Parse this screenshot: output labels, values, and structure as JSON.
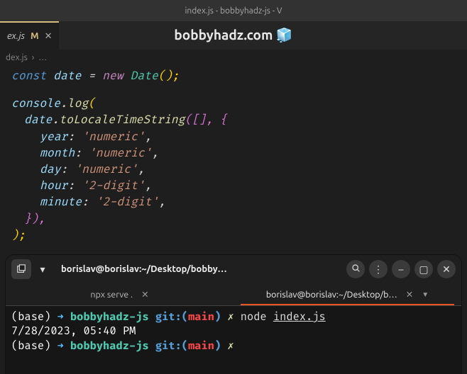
{
  "window": {
    "title": "index.js - bobbyhadz-js - V"
  },
  "overlay": {
    "text": "bobbyhadz.com",
    "icon": "🧊"
  },
  "tab": {
    "name": "ex.js",
    "modified_marker": "M",
    "close": "✕"
  },
  "breadcrumb": {
    "file": "dex.js",
    "sep": "›",
    "more": "…"
  },
  "code": {
    "l1": {
      "const": "const",
      "date": "date",
      "eq": "=",
      "new": "new",
      "Date": "Date",
      "call": "();"
    },
    "l2": {
      "console": "console",
      "dot": ".",
      "log": "log",
      "open": "("
    },
    "l3": {
      "date": "date",
      "dot": ".",
      "fn": "toLocaleTimeString",
      "args_open": "([], {"
    },
    "l4": {
      "key": "year",
      "val": "'numeric'",
      "comma": ","
    },
    "l5": {
      "key": "month",
      "val": "'numeric'",
      "comma": ","
    },
    "l6": {
      "key": "day",
      "val": "'numeric'",
      "comma": ","
    },
    "l7": {
      "key": "hour",
      "val": "'2-digit'",
      "comma": ","
    },
    "l8": {
      "key": "minute",
      "val": "'2-digit'",
      "comma": ","
    },
    "l9": {
      "close": "}),"
    },
    "l10": {
      "close": ");"
    }
  },
  "terminal": {
    "header_title": "borislav@borislav:~/Desktop/bobbyhadz-r…",
    "tabs": {
      "t1": "npx serve .",
      "t2": "borislav@borislav:~/Desktop/b…"
    },
    "lines": {
      "prompt_base": "(base)",
      "arrow": "➜",
      "dir": "bobbyhadz-js",
      "git": "git:(",
      "branch": "main",
      "gitclose": ")",
      "lightning": "✗",
      "cmd_node": "node",
      "cmd_file": "index.js",
      "output": "7/28/2023, 05:40 PM"
    }
  }
}
